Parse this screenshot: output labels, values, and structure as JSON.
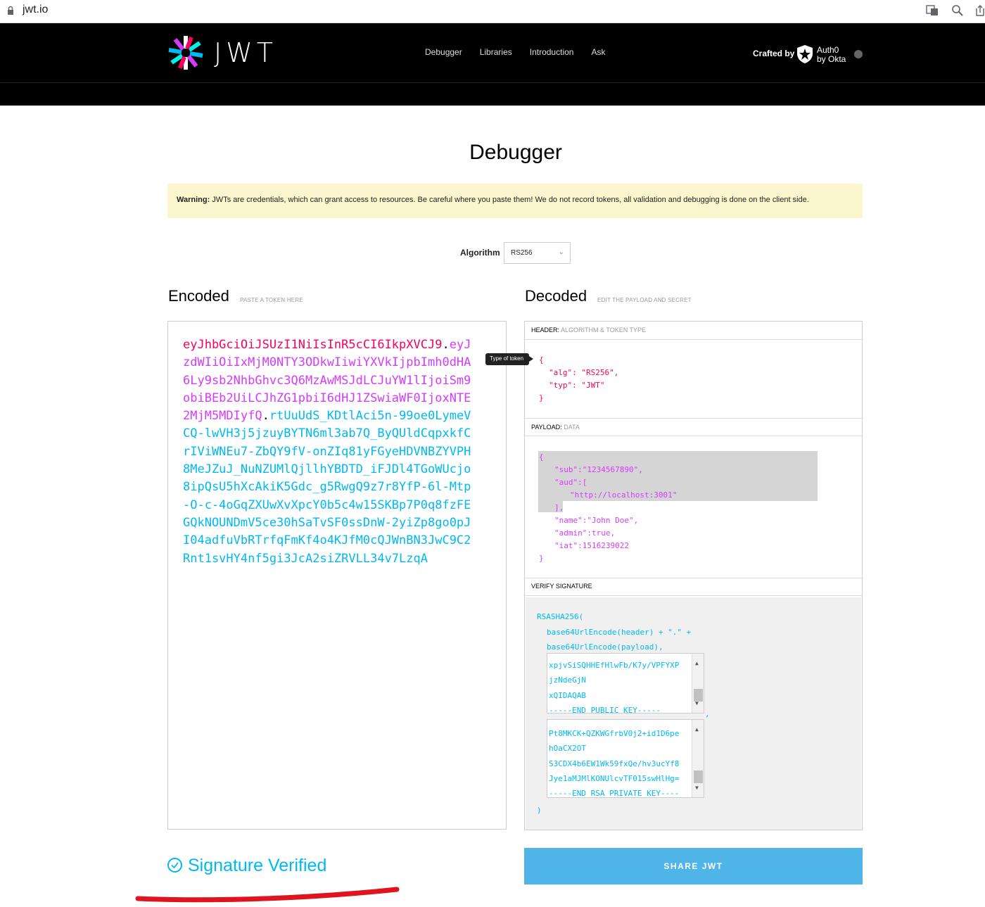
{
  "browser": {
    "url": "jwt.io"
  },
  "nav": {
    "logo_text": "JWT",
    "links": [
      "Debugger",
      "Libraries",
      "Introduction",
      "Ask"
    ],
    "crafted_by": "Crafted by",
    "auth0_line1": "Auth0",
    "auth0_line2": "by Okta"
  },
  "page_title": "Debugger",
  "warning": {
    "label": "Warning:",
    "text": " JWTs are credentials, which can grant access to resources. Be careful where you paste them! We do not record tokens, all validation and debugging is done on the client side."
  },
  "algorithm": {
    "label": "Algorithm",
    "value": "RS256"
  },
  "encoded": {
    "title": "Encoded",
    "subtitle": "PASTE A TOKEN HERE",
    "header_part": "eyJhbGciOiJSUzI1NiIsInR5cCI6IkpXVCJ9",
    "payload_part": "eyJzdWIiOiIxMjM0NTY3ODkwIiwiYXVkIjpbImh0dHA6Ly9sb2NhbGhvc3Q6MzAwMSJdLCJuYW1lIjoiSm9obiBEb2UiLCJhZG1pbiI6dHJ1ZSwiaWF0IjoxNTE2MjM5MDIyfQ",
    "signature_part": "rtUuUdS_KDtlAci5n-99oe0LymeVCQ-lwVH3j5jzuyBYTN6ml3ab7Q_ByQUldCqpxkfCrIViWNEu7-ZbQY9fV-onZIq81yFGyeHDVNBZYVPH8MeJZuJ_NuNZUMlQjllhYBDTD_iFJDl4TGoWUcjo8ipQsU5hXcAkiK5Gdc_g5RwgQ9z7r8YfP-6l-Mtp-O-c-4oGqZXUwXvXpcY0b5c4w15SKBp7P0q8fzFEGQkNOUNDmV5ce30hSaTvSF0ssDnW-2yiZp8go0pJI04adfuVbRTrfqFmKf4o4KJfM0cQJWnBN3JwC9C2Rnt1svHY4nf5gi3JcA2siZRVLL34v7LzqA",
    "dot": "."
  },
  "decoded": {
    "title": "Decoded",
    "subtitle": "EDIT THE PAYLOAD AND SECRET",
    "header_label": "HEADER:",
    "header_sub": "ALGORITHM & TOKEN TYPE",
    "payload_label": "PAYLOAD:",
    "payload_sub": "DATA",
    "verify_label": "VERIFY SIGNATURE",
    "tooltip": "Type of token",
    "header_lines": [
      "{",
      "\"alg\": \"RS256\",",
      "\"typ\": \"JWT\"",
      "}"
    ],
    "payload_lines": [
      "{",
      "\"sub\":\"1234567890\",",
      "\"aud\":[",
      "\"http://localhost:3001\"",
      "],",
      "\"name\":\"John Doe\",",
      "\"admin\":true,",
      "\"iat\":1516239022",
      "}"
    ],
    "verify_lines": [
      "RSASHA256(",
      "base64UrlEncode(header) + \".\" +",
      "base64UrlEncode(payload),",
      ")"
    ],
    "public_key_lines": [
      "xpjvSiSQHHEfHlwFb/K7y/VPFYXP",
      "jzNdeGjN",
      "xQIDAQAB",
      "-----END PUBLIC KEY-----"
    ],
    "private_key_lines": [
      "Pt8MKCK+QZKWGfrbV0j2+id1D6pe",
      "hOaCX2OT",
      "S3CDX4b6EW1Wk59fxQe/hv3ucYf8",
      "Jye1aMJMlKONUlcvTF015swHlHg=",
      "-----END RSA PRIVATE KEY----"
    ],
    "comma": ","
  },
  "signature_status": "Signature Verified",
  "share_button": "SHARE JWT",
  "colors": {
    "header": "#fb015b",
    "payload": "#d63aff",
    "signature": "#00b9f1",
    "share": "#4fb5e8",
    "warning_bg": "#fbf6cd"
  }
}
